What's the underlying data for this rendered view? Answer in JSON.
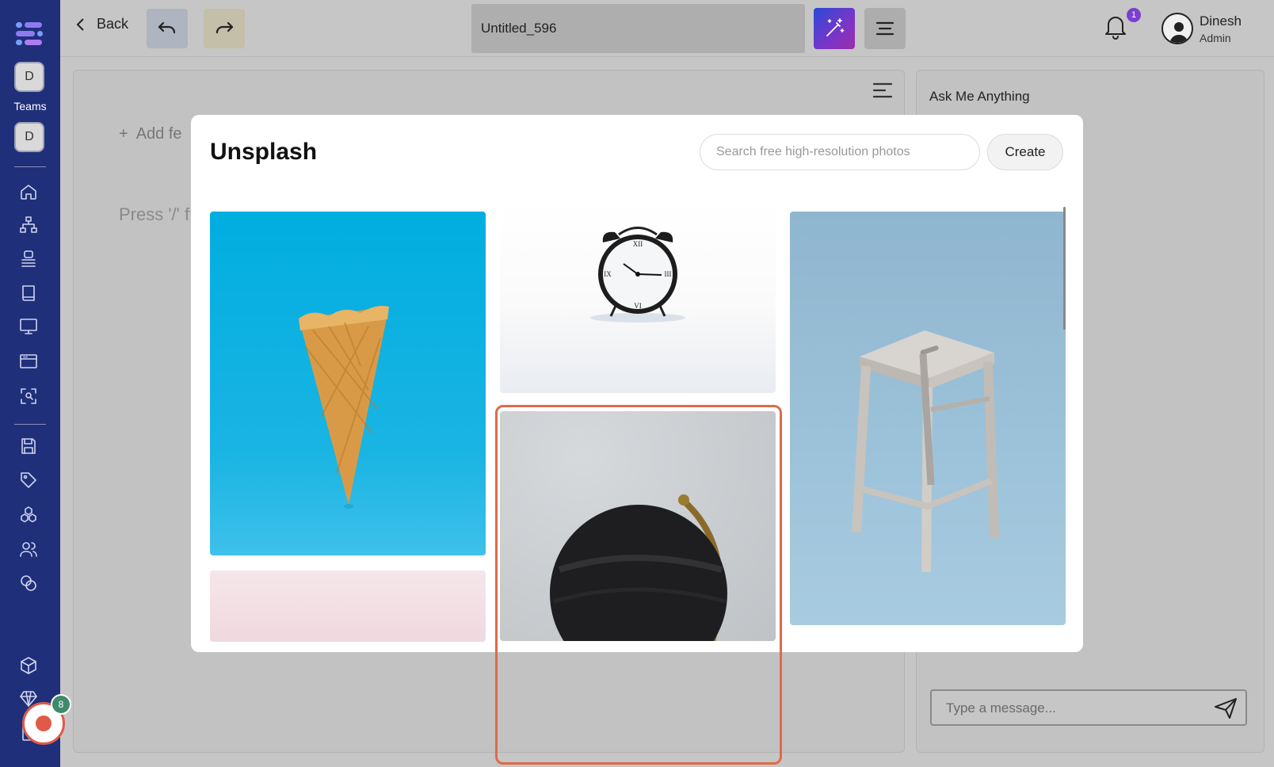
{
  "sidebar": {
    "team_initial_top": "D",
    "teams_label": "Teams",
    "team_initial_bottom": "D",
    "record_badge": "8",
    "icons": [
      "home-icon",
      "hierarchy-icon",
      "stack-icon",
      "book-icon",
      "monitor-icon",
      "browser-window-icon",
      "scan-icon",
      "save-icon",
      "tag-icon",
      "cubes-icon",
      "users-icon",
      "coins-icon",
      "package-icon",
      "diamond-icon",
      "clipboard-icon"
    ]
  },
  "topbar": {
    "back_label": "Back",
    "document_title": "Untitled_596",
    "notification_count": "1",
    "user_name": "Dinesh",
    "user_role": "Admin"
  },
  "editor": {
    "add_feature": "Add fe",
    "press_hint": "Press '/' f"
  },
  "chat": {
    "title": "Ask Me Anything",
    "input_placeholder": "Type a message..."
  },
  "modal": {
    "title": "Unsplash",
    "search_placeholder": "Search free high-resolution photos",
    "create_label": "Create",
    "photos": [
      "ice-cream-cone",
      "pink-background",
      "alarm-clock",
      "black-globe",
      "wooden-stool"
    ]
  },
  "colors": {
    "sidebar_bg": "#1f2f7a",
    "highlight": "#e06a4a",
    "record": "#e05a48",
    "badge_purple": "#7b3fd0"
  }
}
